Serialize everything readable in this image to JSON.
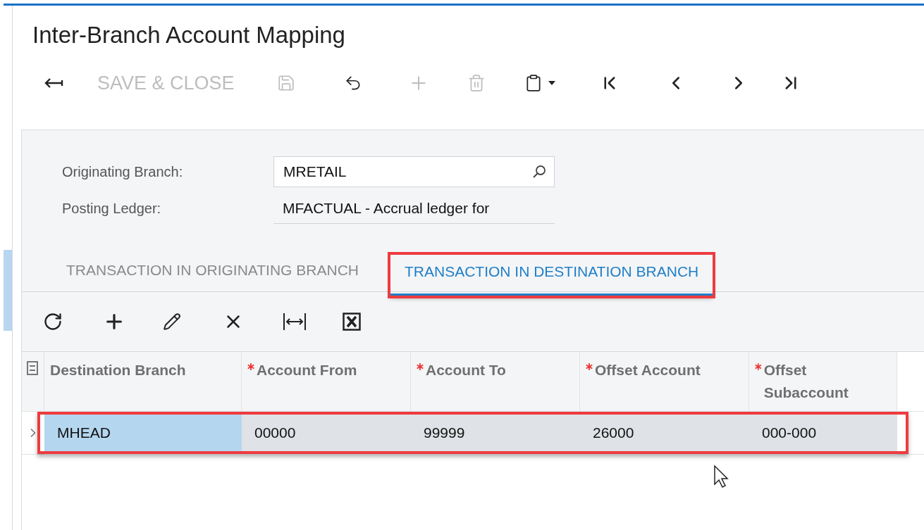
{
  "window": {
    "title": "Inter-Branch Account Mapping"
  },
  "toolbar": [
    {
      "kind": "back",
      "disabled": false
    },
    {
      "kind": "text",
      "label": "SAVE & CLOSE",
      "disabled": true
    },
    {
      "kind": "save",
      "disabled": true
    },
    {
      "kind": "undo",
      "disabled": false
    },
    {
      "kind": "add",
      "disabled": true
    },
    {
      "kind": "delete",
      "disabled": true
    },
    {
      "kind": "clipboard",
      "disabled": false
    },
    {
      "kind": "first",
      "disabled": false
    },
    {
      "kind": "previous",
      "disabled": false
    },
    {
      "kind": "next",
      "disabled": false
    },
    {
      "kind": "last",
      "disabled": false
    }
  ],
  "form": {
    "fields": [
      {
        "label": "Originating Branch:",
        "value": "MRETAIL",
        "kind": "lookup"
      },
      {
        "label": "Posting Ledger:",
        "value": "MFACTUAL - Accrual ledger for",
        "kind": "readonly"
      }
    ]
  },
  "tabs": [
    {
      "label": "TRANSACTION IN ORIGINATING BRANCH",
      "selected": false,
      "highlighted": false
    },
    {
      "label": "TRANSACTION IN DESTINATION BRANCH",
      "selected": true,
      "highlighted": true
    }
  ],
  "grid_toolbar": [
    {
      "kind": "refresh"
    },
    {
      "kind": "add"
    },
    {
      "kind": "edit"
    },
    {
      "kind": "delete"
    },
    {
      "kind": "fit"
    },
    {
      "kind": "export"
    }
  ],
  "table": {
    "columns": [
      {
        "label": "Destination Branch",
        "required": false
      },
      {
        "label": "Account From",
        "required": true
      },
      {
        "label": "Account To",
        "required": true
      },
      {
        "label": "Offset Account",
        "required": true
      },
      {
        "label": "Offset Subaccount",
        "required": true
      }
    ],
    "rows": [
      {
        "cells": [
          "MHEAD",
          "00000",
          "99999",
          "26000",
          "000-000"
        ],
        "selected": true,
        "highlighted": true
      }
    ]
  }
}
